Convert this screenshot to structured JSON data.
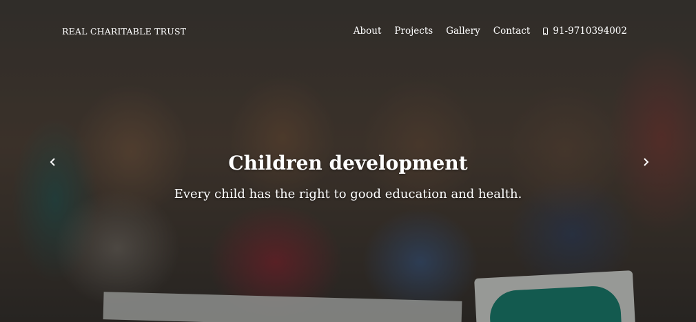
{
  "navbar": {
    "brand": "REAL CHARITABLE TRUST",
    "links": [
      "About",
      "Projects",
      "Gallery",
      "Contact"
    ],
    "phone": {
      "icon": "mobile-phone-icon",
      "number": "91-9710394002"
    }
  },
  "hero": {
    "title": "Children development",
    "subtitle": "Every child has the right to good education and health.",
    "prev_icon": "chevron-left-icon",
    "next_icon": "chevron-right-icon"
  }
}
